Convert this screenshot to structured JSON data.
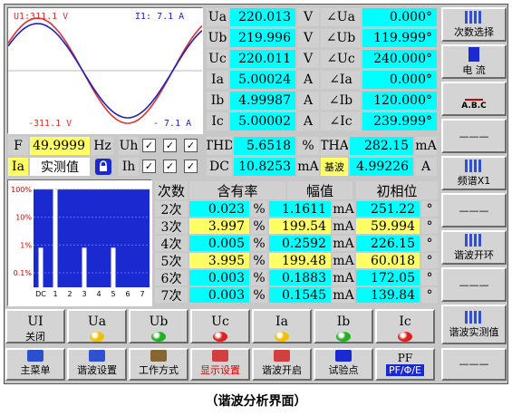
{
  "wave": {
    "u_label": "U1:311.1 V",
    "i_label": "I1:  7.1 A",
    "u_neg": "-311.1 V",
    "i_neg": "- 7.1 A"
  },
  "phasor": {
    "rows": [
      {
        "name": "Ua",
        "value": "220.013",
        "unit": "V",
        "angle_name": "∠Ua",
        "angle": "0.000°"
      },
      {
        "name": "Ub",
        "value": "219.996",
        "unit": "V",
        "angle_name": "∠Ub",
        "angle": "119.999°"
      },
      {
        "name": "Uc",
        "value": "220.011",
        "unit": "V",
        "angle_name": "∠Uc",
        "angle": "240.000°"
      },
      {
        "name": "Ia",
        "value": "5.00024",
        "unit": "A",
        "angle_name": "∠Ia",
        "angle": "0.000°"
      },
      {
        "name": "Ib",
        "value": "4.99987",
        "unit": "A",
        "angle_name": "∠Ib",
        "angle": "120.000°"
      },
      {
        "name": "Ic",
        "value": "5.00002",
        "unit": "A",
        "angle_name": "∠Ic",
        "angle": "239.999°"
      }
    ]
  },
  "freq": {
    "label": "F",
    "value": "49.9999",
    "unit": "Hz"
  },
  "mode": {
    "channel": "Ia",
    "label": "实测值"
  },
  "uh_label": "Uh",
  "ih_label": "Ih",
  "check_mark": "✓",
  "thd": {
    "label": "THD",
    "value": "5.6518",
    "unit": "%",
    "tha_label": "THA",
    "tha_value": "282.15",
    "tha_unit": "mA"
  },
  "dc": {
    "label": "DC",
    "value": "10.8253",
    "unit": "mA",
    "fund_label": "基波",
    "fund_value": "4.99226",
    "fund_unit": "A"
  },
  "chart_data": {
    "type": "bar",
    "categories": [
      "DC",
      "1",
      "2",
      "3",
      "4",
      "5",
      "6",
      "7"
    ],
    "values": [
      0.8,
      100,
      0.02,
      0.8,
      0.02,
      0.8,
      0.02,
      0.02
    ],
    "y_ticks": [
      "100%",
      "10%",
      "1%",
      "0.1%"
    ],
    "scale": "log"
  },
  "harm_table": {
    "headers": [
      "次数",
      "含有率",
      "幅值",
      "初相位"
    ],
    "rows": [
      {
        "order": "2次",
        "rate": "0.023",
        "rate_unit": "%",
        "amp": "1.1611",
        "amp_unit": "mA",
        "phase": "251.22",
        "phase_unit": "°",
        "hl": false
      },
      {
        "order": "3次",
        "rate": "3.997",
        "rate_unit": "%",
        "amp": "199.54",
        "amp_unit": "mA",
        "phase": "59.994",
        "phase_unit": "°",
        "hl": true
      },
      {
        "order": "4次",
        "rate": "0.005",
        "rate_unit": "%",
        "amp": "0.2592",
        "amp_unit": "mA",
        "phase": "226.15",
        "phase_unit": "°",
        "hl": false
      },
      {
        "order": "5次",
        "rate": "3.995",
        "rate_unit": "%",
        "amp": "199.48",
        "amp_unit": "mA",
        "phase": "60.018",
        "phase_unit": "°",
        "hl": true
      },
      {
        "order": "6次",
        "rate": "0.003",
        "rate_unit": "%",
        "amp": "0.1883",
        "amp_unit": "mA",
        "phase": "172.05",
        "phase_unit": "°",
        "hl": false
      },
      {
        "order": "7次",
        "rate": "0.003",
        "rate_unit": "%",
        "amp": "0.1545",
        "amp_unit": "mA",
        "phase": "139.84",
        "phase_unit": "°",
        "hl": false
      }
    ]
  },
  "channels": [
    {
      "name": "UI",
      "sub": "关闭",
      "color": ""
    },
    {
      "name": "Ua",
      "sub": "",
      "color": "#f0c000"
    },
    {
      "name": "Ub",
      "sub": "",
      "color": "#20b020"
    },
    {
      "name": "Uc",
      "sub": "",
      "color": "#e02020"
    },
    {
      "name": "Ia",
      "sub": "",
      "color": "#f0c000"
    },
    {
      "name": "Ib",
      "sub": "",
      "color": "#20b020"
    },
    {
      "name": "Ic",
      "sub": "",
      "color": "#e02020"
    }
  ],
  "right_menu": [
    "次数选择",
    "电 流",
    "A.B.C",
    "———",
    "频谱X1",
    "———",
    "谐波开环",
    "———",
    "谐波实测值"
  ],
  "bottom_menu": [
    "主菜单",
    "谐波设置",
    "工作方式",
    "显示设置",
    "谐波开启",
    "试验点",
    "PF/Φ/E",
    "———"
  ],
  "bottom_pf": "PF",
  "caption": "（谐波分析界面）"
}
